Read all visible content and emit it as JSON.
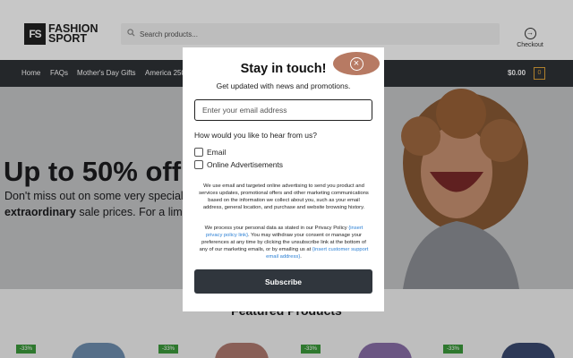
{
  "header": {
    "logo_mark": "FS",
    "logo_line1": "FASHION",
    "logo_line2": "SPORT",
    "search_placeholder": "Search products...",
    "checkout_label": "Checkout",
    "checkout_icon": "arrow-right-circle-icon"
  },
  "nav": {
    "items": [
      "Home",
      "FAQs",
      "Mother's Day Gifts",
      "America 250"
    ],
    "cart_total": "$0.00",
    "cart_count": "0"
  },
  "hero": {
    "heading": "Up to 50% off",
    "sub_text": "Don't miss out on some very special i",
    "sub_bold": "extraordinary",
    "sub_rest": " sale prices. For a limite"
  },
  "featured": {
    "title": "Featured Products",
    "badges": [
      "-33%",
      "-33%",
      "-33%",
      "-33%"
    ]
  },
  "modal": {
    "title": "Stay in touch!",
    "subtitle": "Get updated with news and promotions.",
    "email_placeholder": "Enter your email address",
    "question": "How would you like to hear from us?",
    "options": [
      "Email",
      "Online Advertisements"
    ],
    "consent_1": "We use email and targeted online advertising to send you product and services updates, promotional offers and other marketing communications based on the information we collect about you, such as your email address, general location, and purchase and website browsing history.",
    "consent_2_a": "We process your personal data as stated in our Privacy Policy",
    "consent_2_link1": "{insert privacy policy link}",
    "consent_2_b": ". You may withdraw your consent or manage your preferences at any time by clicking the unsubscribe link at the bottom of any of our marketing emails, or by emailing us at",
    "consent_2_link2": "{insert customer support email address}",
    "consent_2_c": ".",
    "subscribe_label": "Subscribe",
    "close_icon": "close-icon"
  },
  "colors": {
    "nav_bg": "#2f3237",
    "accent": "#e0a43a",
    "close_highlight": "#b77a63",
    "subscribe_bg": "#30363d",
    "link": "#2a7fd4",
    "badge_green": "#3c9a3c"
  }
}
